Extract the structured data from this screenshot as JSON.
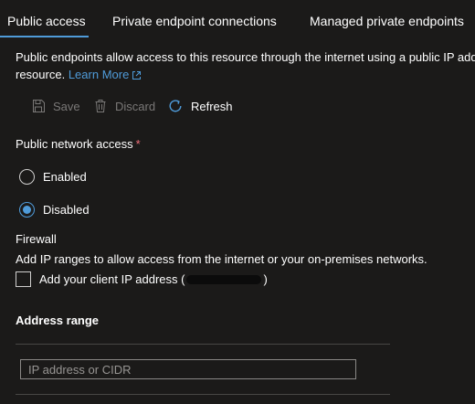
{
  "tabs": [
    {
      "label": "Public access",
      "active": true
    },
    {
      "label": "Private endpoint connections",
      "active": false
    },
    {
      "label": "Managed private endpoints",
      "active": false
    }
  ],
  "description": {
    "line1": "Public endpoints allow access to this resource through the internet using a public IP addr",
    "line2_prefix": "resource.",
    "learn_more": "Learn More"
  },
  "toolbar": {
    "save_label": "Save",
    "discard_label": "Discard",
    "refresh_label": "Refresh"
  },
  "public_network_access": {
    "label": "Public network access",
    "required_marker": "*",
    "options": [
      {
        "label": "Enabled",
        "selected": false
      },
      {
        "label": "Disabled",
        "selected": true
      }
    ]
  },
  "firewall": {
    "title": "Firewall",
    "description": "Add IP ranges to allow access from the internet or your on-premises networks.",
    "client_ip_checkbox": {
      "label_prefix": "Add your client IP address (",
      "label_suffix": ")",
      "checked": false
    }
  },
  "address_range": {
    "title": "Address range",
    "input_placeholder": "IP address or CIDR",
    "input_value": ""
  },
  "colors": {
    "background": "#1b1a19",
    "accent": "#4f9bd9",
    "required": "#f1707b",
    "disabled_text": "#7a7877"
  }
}
